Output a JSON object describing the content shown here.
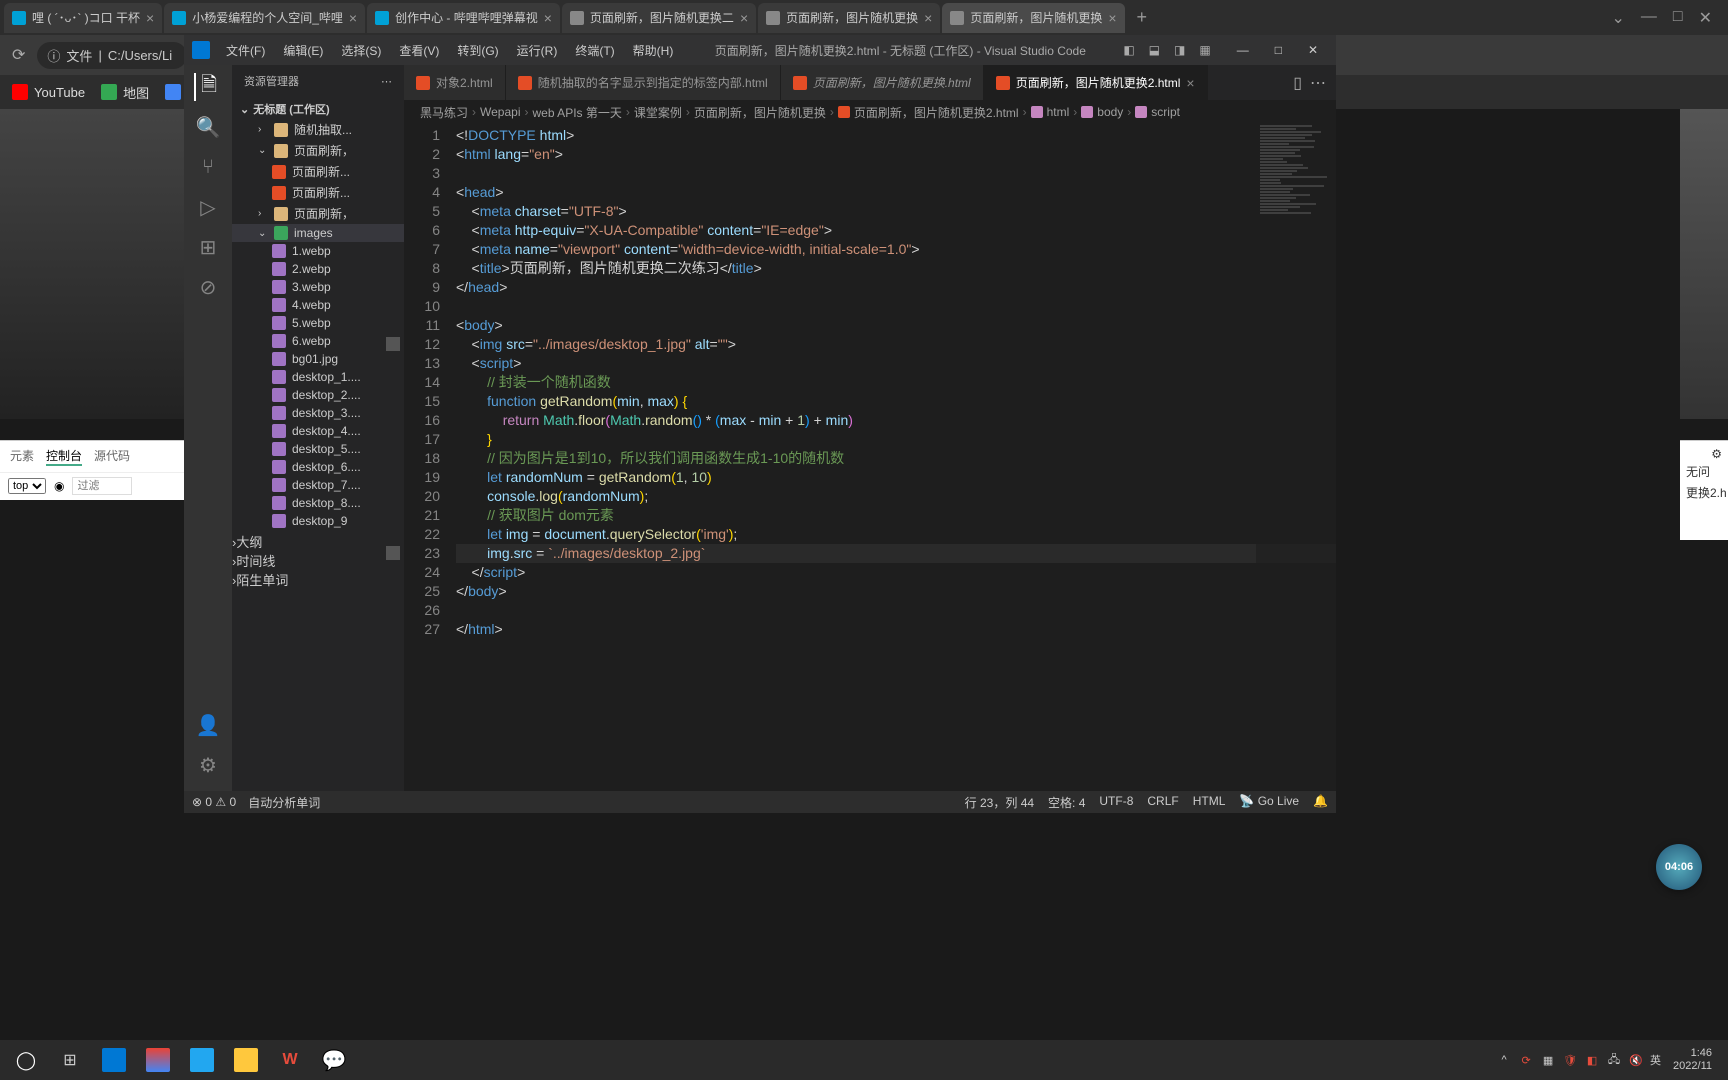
{
  "browser": {
    "tabs": [
      {
        "title": "哩 ( ´･ᴗ･` )コ口 干杯",
        "icon": "bili"
      },
      {
        "title": "小杨爱编程的个人空间_哔哩",
        "icon": "bili"
      },
      {
        "title": "创作中心 - 哔哩哔哩弹幕视",
        "icon": "bili"
      },
      {
        "title": "页面刷新，图片随机更换二",
        "icon": "page"
      },
      {
        "title": "页面刷新，图片随机更换",
        "icon": "page"
      },
      {
        "title": "页面刷新，图片随机更换",
        "icon": "page",
        "active": true
      }
    ],
    "new_tab": "+",
    "addr": {
      "proto": "文件",
      "path": "C:/Users/Li"
    }
  },
  "bookmarks": [
    {
      "label": "YouTube",
      "icon": "yt"
    },
    {
      "label": "地图",
      "icon": "maps"
    },
    {
      "label": "",
      "icon": "trans"
    }
  ],
  "devtools": {
    "tabs": [
      "元素",
      "控制台",
      "源代码"
    ],
    "active_tab": "控制台",
    "filter_top": "top",
    "filter_placeholder": "过滤",
    "right_rows": [
      "无问",
      "更换2.h"
    ]
  },
  "vscode": {
    "menus": [
      "文件(F)",
      "编辑(E)",
      "选择(S)",
      "查看(V)",
      "转到(G)",
      "运行(R)",
      "终端(T)",
      "帮助(H)"
    ],
    "title": "页面刷新，图片随机更换2.html - 无标题 (工作区) - Visual Studio Code",
    "sidebar": {
      "header": "资源管理器",
      "workspace": "无标题 (工作区)",
      "items": [
        {
          "type": "folder",
          "label": "随机抽取...",
          "chev": "›",
          "indent": 1
        },
        {
          "type": "folder",
          "label": "页面刷新，",
          "chev": "⌄",
          "indent": 1,
          "open": true
        },
        {
          "type": "file-html",
          "label": "页面刷新...",
          "indent": 2
        },
        {
          "type": "file-html",
          "label": "页面刷新...",
          "indent": 2
        },
        {
          "type": "folder",
          "label": "页面刷新，",
          "chev": "›",
          "indent": 1
        },
        {
          "type": "folder-img",
          "label": "images",
          "chev": "⌄",
          "indent": 1,
          "open": true,
          "active": true
        },
        {
          "type": "file-img",
          "label": "1.webp",
          "indent": 2
        },
        {
          "type": "file-img",
          "label": "2.webp",
          "indent": 2
        },
        {
          "type": "file-img",
          "label": "3.webp",
          "indent": 2
        },
        {
          "type": "file-img",
          "label": "4.webp",
          "indent": 2
        },
        {
          "type": "file-img",
          "label": "5.webp",
          "indent": 2
        },
        {
          "type": "file-img",
          "label": "6.webp",
          "indent": 2
        },
        {
          "type": "file-img",
          "label": "bg01.jpg",
          "indent": 2
        },
        {
          "type": "file-img",
          "label": "desktop_1....",
          "indent": 2
        },
        {
          "type": "file-img",
          "label": "desktop_2....",
          "indent": 2
        },
        {
          "type": "file-img",
          "label": "desktop_3....",
          "indent": 2
        },
        {
          "type": "file-img",
          "label": "desktop_4....",
          "indent": 2
        },
        {
          "type": "file-img",
          "label": "desktop_5....",
          "indent": 2
        },
        {
          "type": "file-img",
          "label": "desktop_6....",
          "indent": 2
        },
        {
          "type": "file-img",
          "label": "desktop_7....",
          "indent": 2
        },
        {
          "type": "file-img",
          "label": "desktop_8....",
          "indent": 2
        },
        {
          "type": "file-img",
          "label": "desktop_9",
          "indent": 2
        }
      ],
      "sections": [
        "大纲",
        "时间线",
        "陌生单词"
      ]
    },
    "editor_tabs": [
      {
        "label": "对象2.html",
        "icon": "html"
      },
      {
        "label": "随机抽取的名字显示到指定的标签内部.html",
        "icon": "html"
      },
      {
        "label": "页面刷新，图片随机更换.html",
        "icon": "html",
        "italic": true
      },
      {
        "label": "页面刷新，图片随机更换2.html",
        "icon": "html",
        "active": true
      }
    ],
    "breadcrumb": [
      "黑马练习",
      "Wepapi",
      "web APIs 第一天",
      "课堂案例",
      "页面刷新，图片随机更换",
      "页面刷新，图片随机更换2.html",
      "html",
      "body",
      "script"
    ],
    "code": {
      "lines": [
        [
          {
            "t": "punc",
            "v": "<!"
          },
          {
            "t": "tag",
            "v": "DOCTYPE"
          },
          {
            "t": "punc",
            "v": " "
          },
          {
            "t": "attr",
            "v": "html"
          },
          {
            "t": "punc",
            "v": ">"
          }
        ],
        [
          {
            "t": "punc",
            "v": "<"
          },
          {
            "t": "tag",
            "v": "html"
          },
          {
            "t": "punc",
            "v": " "
          },
          {
            "t": "attr",
            "v": "lang"
          },
          {
            "t": "punc",
            "v": "="
          },
          {
            "t": "str",
            "v": "\"en\""
          },
          {
            "t": "punc",
            "v": ">"
          }
        ],
        [],
        [
          {
            "t": "punc",
            "v": "<"
          },
          {
            "t": "tag",
            "v": "head"
          },
          {
            "t": "punc",
            "v": ">"
          }
        ],
        [
          {
            "t": "punc",
            "v": "    <"
          },
          {
            "t": "tag",
            "v": "meta"
          },
          {
            "t": "punc",
            "v": " "
          },
          {
            "t": "attr",
            "v": "charset"
          },
          {
            "t": "punc",
            "v": "="
          },
          {
            "t": "str",
            "v": "\"UTF-8\""
          },
          {
            "t": "punc",
            "v": ">"
          }
        ],
        [
          {
            "t": "punc",
            "v": "    <"
          },
          {
            "t": "tag",
            "v": "meta"
          },
          {
            "t": "punc",
            "v": " "
          },
          {
            "t": "attr",
            "v": "http-equiv"
          },
          {
            "t": "punc",
            "v": "="
          },
          {
            "t": "str",
            "v": "\"X-UA-Compatible\""
          },
          {
            "t": "punc",
            "v": " "
          },
          {
            "t": "attr",
            "v": "content"
          },
          {
            "t": "punc",
            "v": "="
          },
          {
            "t": "str",
            "v": "\"IE=edge\""
          },
          {
            "t": "punc",
            "v": ">"
          }
        ],
        [
          {
            "t": "punc",
            "v": "    <"
          },
          {
            "t": "tag",
            "v": "meta"
          },
          {
            "t": "punc",
            "v": " "
          },
          {
            "t": "attr",
            "v": "name"
          },
          {
            "t": "punc",
            "v": "="
          },
          {
            "t": "str",
            "v": "\"viewport\""
          },
          {
            "t": "punc",
            "v": " "
          },
          {
            "t": "attr",
            "v": "content"
          },
          {
            "t": "punc",
            "v": "="
          },
          {
            "t": "str",
            "v": "\"width=device-width, initial-scale=1.0\""
          },
          {
            "t": "punc",
            "v": ">"
          }
        ],
        [
          {
            "t": "punc",
            "v": "    <"
          },
          {
            "t": "tag",
            "v": "title"
          },
          {
            "t": "punc",
            "v": ">"
          },
          {
            "t": "punc",
            "v": "页面刷新，图片随机更换二次练习"
          },
          {
            "t": "punc",
            "v": "</"
          },
          {
            "t": "tag",
            "v": "title"
          },
          {
            "t": "punc",
            "v": ">"
          }
        ],
        [
          {
            "t": "punc",
            "v": "</"
          },
          {
            "t": "tag",
            "v": "head"
          },
          {
            "t": "punc",
            "v": ">"
          }
        ],
        [],
        [
          {
            "t": "punc",
            "v": "<"
          },
          {
            "t": "tag",
            "v": "body"
          },
          {
            "t": "punc",
            "v": ">"
          }
        ],
        [
          {
            "t": "punc",
            "v": "    <"
          },
          {
            "t": "tag",
            "v": "img"
          },
          {
            "t": "punc",
            "v": " "
          },
          {
            "t": "attr",
            "v": "src"
          },
          {
            "t": "punc",
            "v": "="
          },
          {
            "t": "str",
            "v": "\"../images/desktop_1.jpg\""
          },
          {
            "t": "punc",
            "v": " "
          },
          {
            "t": "attr",
            "v": "alt"
          },
          {
            "t": "punc",
            "v": "="
          },
          {
            "t": "str",
            "v": "\"\""
          },
          {
            "t": "punc",
            "v": ">"
          }
        ],
        [
          {
            "t": "punc",
            "v": "    <"
          },
          {
            "t": "tag",
            "v": "script"
          },
          {
            "t": "punc",
            "v": ">"
          }
        ],
        [
          {
            "t": "punc",
            "v": "        "
          },
          {
            "t": "cmt",
            "v": "// 封装一个随机函数"
          }
        ],
        [
          {
            "t": "punc",
            "v": "        "
          },
          {
            "t": "tag",
            "v": "function"
          },
          {
            "t": "punc",
            "v": " "
          },
          {
            "t": "fn",
            "v": "getRandom"
          },
          {
            "t": "bracket1",
            "v": "("
          },
          {
            "t": "var",
            "v": "min"
          },
          {
            "t": "punc",
            "v": ", "
          },
          {
            "t": "var",
            "v": "max"
          },
          {
            "t": "bracket1",
            "v": ")"
          },
          {
            "t": "punc",
            "v": " "
          },
          {
            "t": "bracket1",
            "v": "{"
          }
        ],
        [
          {
            "t": "punc",
            "v": "            "
          },
          {
            "t": "kw",
            "v": "return"
          },
          {
            "t": "punc",
            "v": " "
          },
          {
            "t": "type",
            "v": "Math"
          },
          {
            "t": "punc",
            "v": "."
          },
          {
            "t": "fn",
            "v": "floor"
          },
          {
            "t": "bracket2",
            "v": "("
          },
          {
            "t": "type",
            "v": "Math"
          },
          {
            "t": "punc",
            "v": "."
          },
          {
            "t": "fn",
            "v": "random"
          },
          {
            "t": "bracket3",
            "v": "()"
          },
          {
            "t": "punc",
            "v": " * "
          },
          {
            "t": "bracket3",
            "v": "("
          },
          {
            "t": "var",
            "v": "max"
          },
          {
            "t": "punc",
            "v": " - "
          },
          {
            "t": "var",
            "v": "min"
          },
          {
            "t": "punc",
            "v": " + "
          },
          {
            "t": "num",
            "v": "1"
          },
          {
            "t": "bracket3",
            "v": ")"
          },
          {
            "t": "punc",
            "v": " + "
          },
          {
            "t": "var",
            "v": "min"
          },
          {
            "t": "bracket2",
            "v": ")"
          }
        ],
        [
          {
            "t": "punc",
            "v": "        "
          },
          {
            "t": "bracket1",
            "v": "}"
          }
        ],
        [
          {
            "t": "punc",
            "v": "        "
          },
          {
            "t": "cmt",
            "v": "// 因为图片是1到10，所以我们调用函数生成1-10的随机数"
          }
        ],
        [
          {
            "t": "punc",
            "v": "        "
          },
          {
            "t": "tag",
            "v": "let"
          },
          {
            "t": "punc",
            "v": " "
          },
          {
            "t": "var",
            "v": "randomNum"
          },
          {
            "t": "punc",
            "v": " = "
          },
          {
            "t": "fn",
            "v": "getRandom"
          },
          {
            "t": "bracket1",
            "v": "("
          },
          {
            "t": "num",
            "v": "1"
          },
          {
            "t": "punc",
            "v": ", "
          },
          {
            "t": "num",
            "v": "10"
          },
          {
            "t": "bracket1",
            "v": ")"
          }
        ],
        [
          {
            "t": "punc",
            "v": "        "
          },
          {
            "t": "var",
            "v": "console"
          },
          {
            "t": "punc",
            "v": "."
          },
          {
            "t": "fn",
            "v": "log"
          },
          {
            "t": "bracket1",
            "v": "("
          },
          {
            "t": "var",
            "v": "randomNum"
          },
          {
            "t": "bracket1",
            "v": ")"
          },
          {
            "t": "punc",
            "v": ";"
          }
        ],
        [
          {
            "t": "punc",
            "v": "        "
          },
          {
            "t": "cmt",
            "v": "// 获取图片 dom元素"
          }
        ],
        [
          {
            "t": "punc",
            "v": "        "
          },
          {
            "t": "tag",
            "v": "let"
          },
          {
            "t": "punc",
            "v": " "
          },
          {
            "t": "var",
            "v": "img"
          },
          {
            "t": "punc",
            "v": " = "
          },
          {
            "t": "var",
            "v": "document"
          },
          {
            "t": "punc",
            "v": "."
          },
          {
            "t": "fn",
            "v": "querySelector"
          },
          {
            "t": "bracket1",
            "v": "("
          },
          {
            "t": "str",
            "v": "'img'"
          },
          {
            "t": "bracket1",
            "v": ")"
          },
          {
            "t": "punc",
            "v": ";"
          }
        ],
        [
          {
            "t": "punc",
            "v": "        "
          },
          {
            "t": "var",
            "v": "img"
          },
          {
            "t": "punc",
            "v": "."
          },
          {
            "t": "var",
            "v": "src"
          },
          {
            "t": "punc",
            "v": " = "
          },
          {
            "t": "str",
            "v": "`../images/desktop_2.jpg`"
          }
        ],
        [
          {
            "t": "punc",
            "v": "    </"
          },
          {
            "t": "tag",
            "v": "script"
          },
          {
            "t": "punc",
            "v": ">"
          }
        ],
        [
          {
            "t": "punc",
            "v": "</"
          },
          {
            "t": "tag",
            "v": "body"
          },
          {
            "t": "punc",
            "v": ">"
          }
        ],
        [],
        [
          {
            "t": "punc",
            "v": "</"
          },
          {
            "t": "tag",
            "v": "html"
          },
          {
            "t": "punc",
            "v": ">"
          }
        ]
      ],
      "active_line": 23
    },
    "status": {
      "errors": "0",
      "warnings": "0",
      "analyze": "自动分析单词",
      "line_col": "行 23，列 44",
      "spaces": "空格: 4",
      "encoding": "UTF-8",
      "eol": "CRLF",
      "lang": "HTML",
      "golive": "Go Live"
    }
  },
  "video_time": "04:06",
  "taskbar": {
    "clock": {
      "time": "1:46",
      "date": "2022/11"
    },
    "ime": "英"
  }
}
